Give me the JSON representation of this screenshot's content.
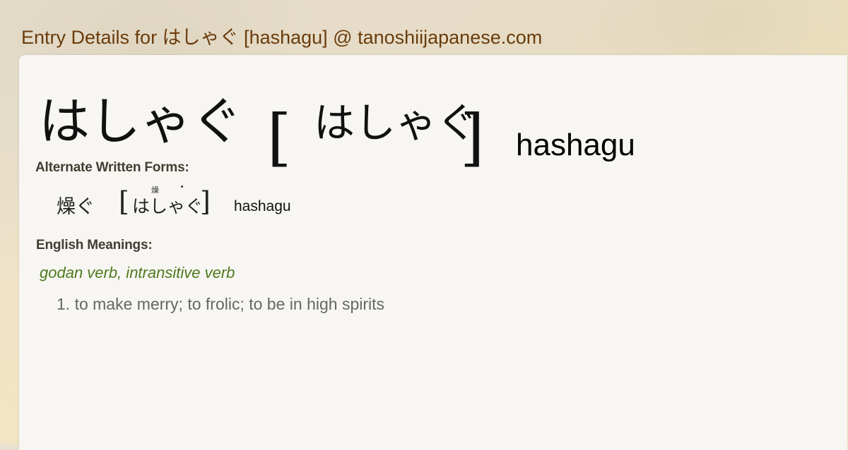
{
  "header": {
    "title": "Entry Details for はしゃぐ [hashagu] @ tanoshiijapanese.com"
  },
  "entry": {
    "word": "はしゃぐ",
    "bracket_open": "[",
    "reading": "はしゃぐ",
    "bracket_close": "]",
    "romaji": "hashagu"
  },
  "alternate_forms": {
    "label": "Alternate Written Forms:",
    "items": [
      {
        "kanji": "燥ぐ",
        "bracket_open": "[",
        "reading": "はしゃぐ",
        "furigana_kanji": "燥",
        "bracket_close": "]",
        "romaji": "hashagu"
      }
    ]
  },
  "meanings": {
    "label": "English Meanings:",
    "part_of_speech": "godan verb, intransitive verb",
    "items": [
      "1. to make merry; to frolic; to be in high spirits"
    ]
  },
  "colors": {
    "header_text": "#6a3c0c",
    "part_of_speech": "#4e7a1e",
    "meaning_text": "#666666",
    "card_background": "#f7f6f2"
  }
}
